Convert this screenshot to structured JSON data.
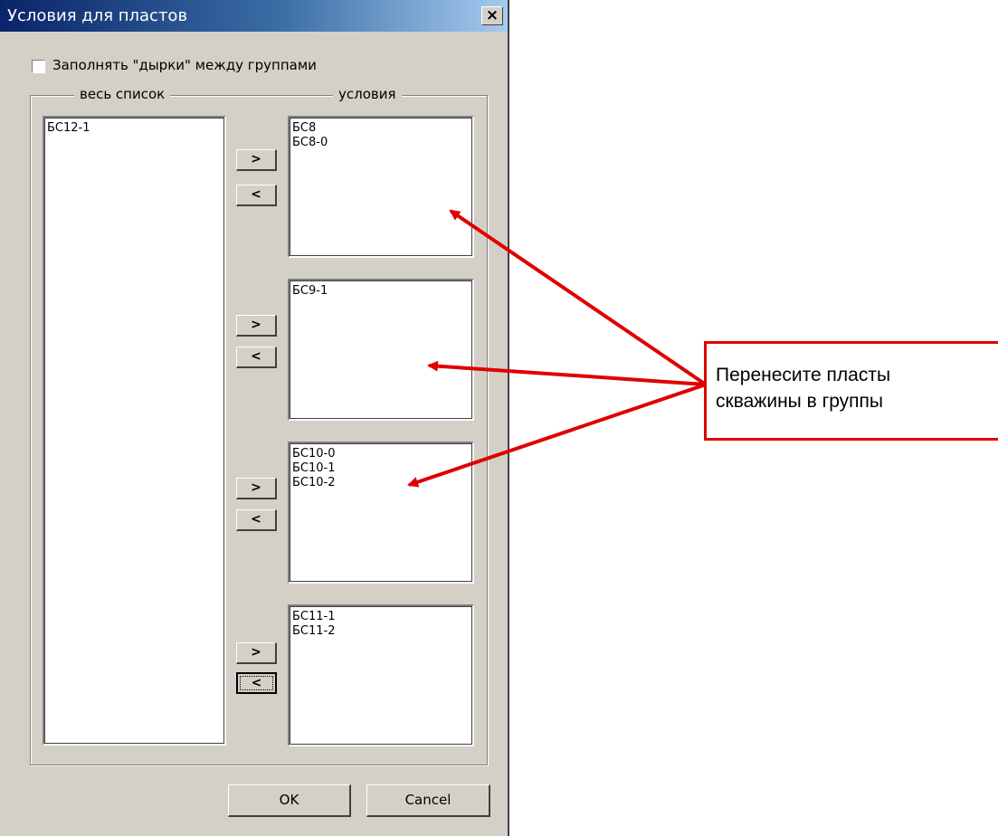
{
  "window": {
    "title": "Условия для пластов",
    "close_label": "×"
  },
  "options": {
    "fill_gaps_label": "Заполнять \"дырки\" между группами",
    "fill_gaps_checked": false
  },
  "group": {
    "left_legend": "весь список",
    "right_legend": "условия"
  },
  "all_list": {
    "items": [
      "БС12-1"
    ]
  },
  "condition_groups": [
    {
      "items": [
        "БС8",
        "БС8-0"
      ]
    },
    {
      "items": [
        "БС9-1"
      ]
    },
    {
      "items": [
        "БС10-0",
        "БС10-1",
        "БС10-2"
      ]
    },
    {
      "items": [
        "БС11-1",
        "БС11-2"
      ]
    }
  ],
  "move_buttons": {
    "right_label": ">",
    "left_label": "<"
  },
  "footer": {
    "ok_label": "OK",
    "cancel_label": "Cancel"
  },
  "annotation": {
    "text_line1": "Перенесите пласты",
    "text_line2": "скважины в группы",
    "color": "#e00000"
  }
}
